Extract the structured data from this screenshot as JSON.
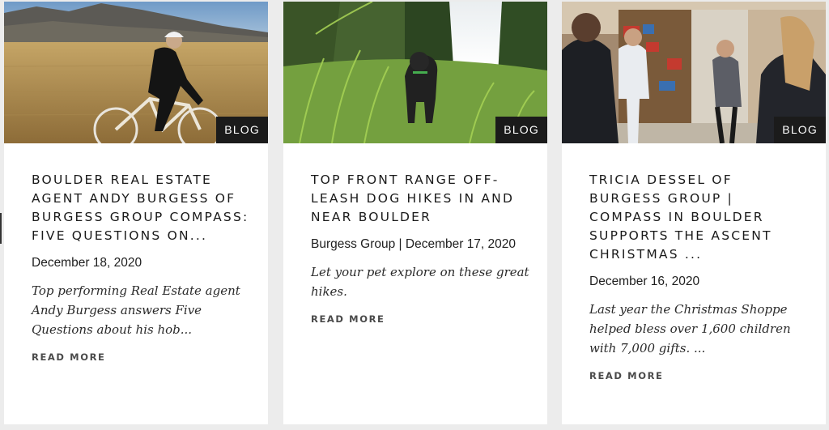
{
  "cards": [
    {
      "badge": "BLOG",
      "image": "cyclist-in-golden-field",
      "title": "BOULDER REAL ESTATE AGENT ANDY BURGESS OF BURGESS GROUP COMPASS: FIVE QUESTIONS ON...",
      "meta": "December 18, 2020",
      "excerpt": "Top performing Real Estate agent Andy Burgess answers Five Questions about his hob...",
      "read_more": "READ MORE"
    },
    {
      "badge": "BLOG",
      "image": "black-dog-in-tall-grass",
      "title": "TOP FRONT RANGE OFF-LEASH DOG HIKES IN AND NEAR BOULDER",
      "meta": "Burgess Group | December 17, 2020",
      "excerpt": "Let your pet explore on these great hikes.",
      "read_more": "READ MORE"
    },
    {
      "badge": "BLOG",
      "image": "people-in-toy-store",
      "title": "TRICIA DESSEL OF BURGESS GROUP | COMPASS IN BOULDER SUPPORTS THE ASCENT CHRISTMAS ...",
      "meta": "December 16, 2020",
      "excerpt": "Last year the Christmas Shoppe helped bless over 1,600 children with 7,000 gifts. ...",
      "read_more": "READ MORE"
    }
  ],
  "colors": {
    "badge_bg": "#1b1b1b",
    "card_bg": "#ffffff",
    "page_bg": "#ececec",
    "title_text": "#1a1a1a",
    "read_more_text": "#4a4a4a"
  }
}
